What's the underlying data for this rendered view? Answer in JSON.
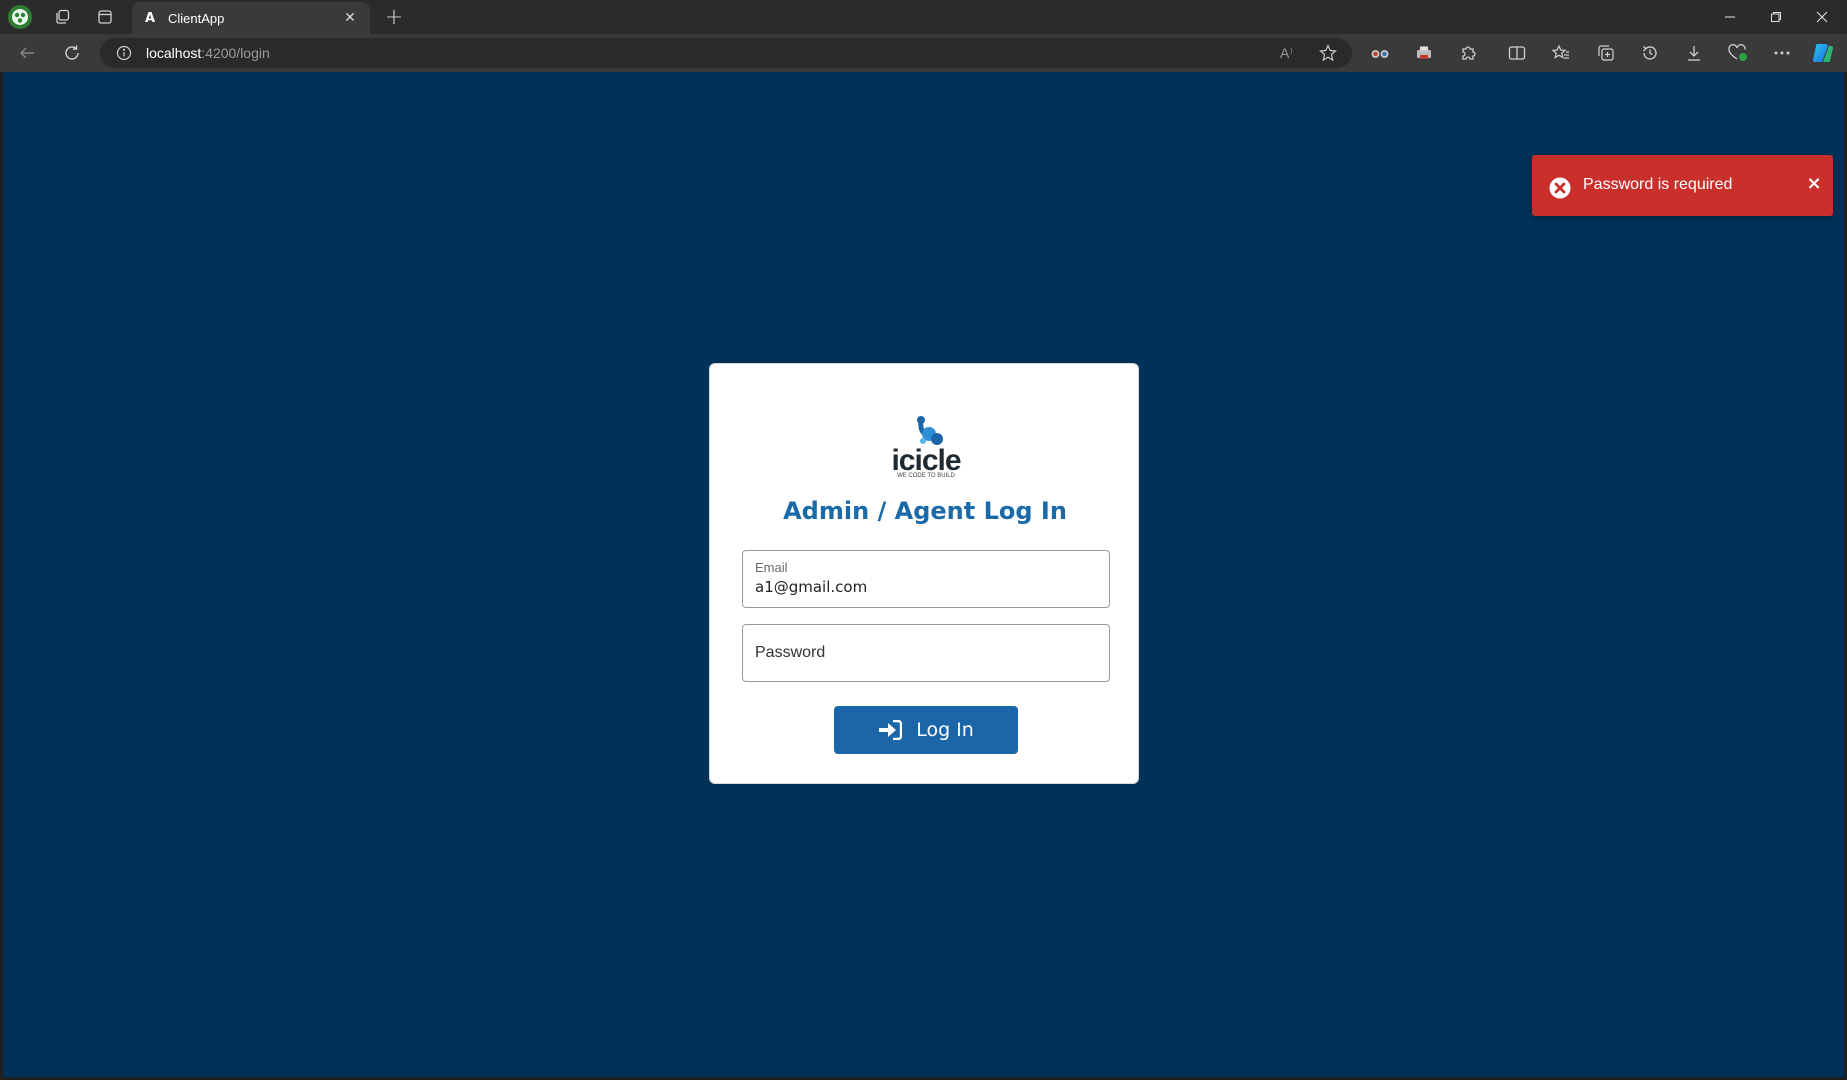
{
  "browser": {
    "tab": {
      "title": "ClientApp",
      "favicon_letter": "A",
      "close_glyph": "✕"
    },
    "new_tab_glyph": "+",
    "address": {
      "host": "localhost",
      "path": ":4200/login"
    },
    "icons": {
      "profile": "profile-avatar-icon",
      "workspaces": "workspaces-icon",
      "tab_actions": "tab-actions-icon",
      "back": "back-arrow-icon",
      "refresh": "refresh-icon",
      "site_info": "info-icon",
      "read_aloud": "read-aloud-icon",
      "favorite": "star-icon",
      "copilot": "copilot-icon"
    },
    "window_controls": {
      "minimize": "—",
      "restore": "❐",
      "close": "✕"
    }
  },
  "login": {
    "logo_text": "icicle",
    "logo_tagline": "WE CODE TO BUILD",
    "title": "Admin / Agent Log In",
    "email": {
      "label": "Email",
      "value": "a1@gmail.com"
    },
    "password": {
      "placeholder": "Password"
    },
    "submit_label": "Log In"
  },
  "toast": {
    "message": "Password is required",
    "close_glyph": "×",
    "color": "#c9302c"
  },
  "colors": {
    "page_background": "#003259",
    "accent": "#1a66a8",
    "title": "#1a6aa8"
  }
}
